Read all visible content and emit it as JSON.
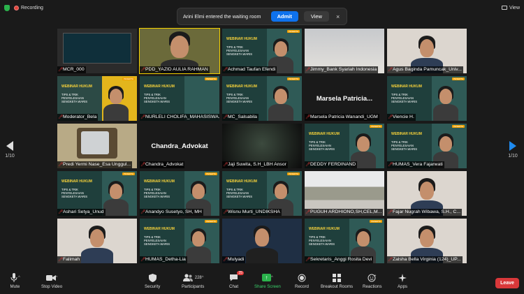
{
  "topbar": {
    "recording": "Recording",
    "view": "View"
  },
  "notification": {
    "message": "Arini Elmi entered the waiting room",
    "admit": "Admit",
    "view": "View",
    "close": "×"
  },
  "pager": {
    "left": "1/10",
    "right": "1/10"
  },
  "slide": {
    "badge": "PESERTA",
    "title": "WEBINAR HUKUM",
    "subtitle": "TIPS & TRIK PENYELESAIAN SENGKETA WARIS"
  },
  "tiles": [
    {
      "name": "MCR_000"
    },
    {
      "name": "PDD_YAZID AULIA RAHMAN"
    },
    {
      "name": "Achmad Taufan Efendi"
    },
    {
      "name": "Jimmy_Bank Syariah Indonesia"
    },
    {
      "name": "Agus Baginda Pamuncak_Univ..."
    },
    {
      "name": "Moderator_Bela"
    },
    {
      "name": "NURLELI CHOLIFA_MAHASISWA..."
    },
    {
      "name": "MC_Salsabila"
    },
    {
      "name": "Marsela Patricia Wanandi_UGM",
      "display": "Marsela Patricia..."
    },
    {
      "name": "Viencie H."
    },
    {
      "name": "Predi Yermi Nase_Esa Unggul..."
    },
    {
      "name": "Chandra_Advokat",
      "display": "Chandra_Advokat"
    },
    {
      "name": "Jaji Suwita, S.H_LBH Ansor"
    },
    {
      "name": "DEDDY FERDINAND"
    },
    {
      "name": "HUMAS_Vera Fajarwati"
    },
    {
      "name": "Ashari Setya_Unud"
    },
    {
      "name": "Anandyo Susetyo, SH, MH"
    },
    {
      "name": "Wisnu Murti_UNDIKSHA"
    },
    {
      "name": "PUGUH ARDHIONO,SH,CEL,M..."
    },
    {
      "name": "Fajar Nugrah Wibawa, S.H., C..."
    },
    {
      "name": "Falimah"
    },
    {
      "name": "HUMAS_Detha-Lia"
    },
    {
      "name": "Mulyadi"
    },
    {
      "name": "Sekretaris_Anggi Rosita Devi"
    },
    {
      "name": "Zalsha Bella Virginia (124)_UP..."
    }
  ],
  "toolbar": {
    "mute": "Mute",
    "stop_video": "Stop Video",
    "security": "Security",
    "participants": "Participants",
    "participants_count": "228",
    "chat": "Chat",
    "chat_badge": "25",
    "share_screen": "Share Screen",
    "record": "Record",
    "breakout_rooms": "Breakout Rooms",
    "reactions": "Reactions",
    "apps": "Apps",
    "leave": "Leave"
  },
  "colors": {
    "accent": "#0e72ed",
    "leave": "#d9383a",
    "active_speaker": "#f3d000",
    "share": "#2bb24c"
  }
}
